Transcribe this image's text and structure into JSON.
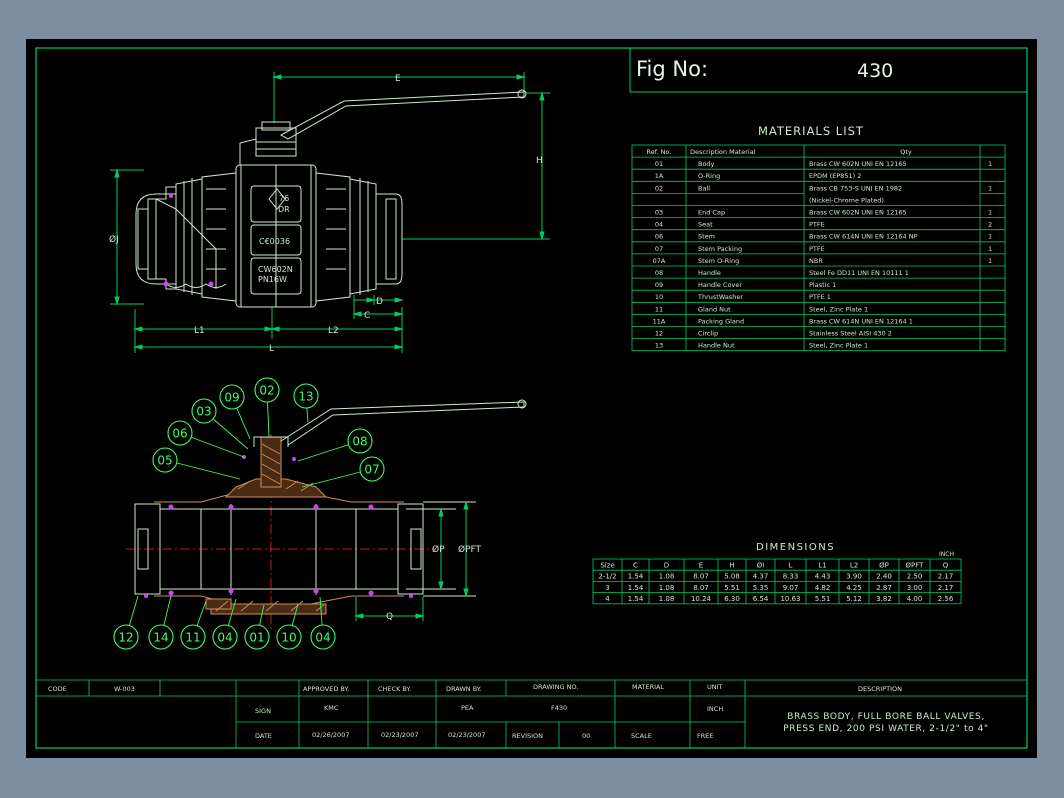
{
  "fig": {
    "label": "Fig  No:",
    "number": "430"
  },
  "materials": {
    "title": "MATERIALS LIST",
    "headers": [
      "Ref. No.",
      "Description  Material",
      "Qty"
    ],
    "rows": [
      [
        "01",
        "Body",
        "Brass CW 602N UNI EN 12165",
        "1"
      ],
      [
        "1A",
        "O-Ring",
        "EPDM (EP851)     2",
        ""
      ],
      [
        "02",
        "Ball",
        "Brass CB 753-S UNI EN 1982",
        "1"
      ],
      [
        "",
        "",
        "(Nickel-Chrome Plated)",
        ""
      ],
      [
        "03",
        "End Cap",
        "Brass CW 602N UNI EN 12165",
        "1"
      ],
      [
        "04",
        "Seat",
        "PTFE",
        "2"
      ],
      [
        "06",
        "Stem",
        "Brass CW 614N UNI EN 12164 NP",
        "1"
      ],
      [
        "07",
        "Stem Packing",
        "PTFE",
        "1"
      ],
      [
        "07A",
        "Stem O-Ring",
        "NBR",
        "1"
      ],
      [
        "08",
        "Handle",
        "Steel Fe DD11 UNI EN 10111  1",
        ""
      ],
      [
        "09",
        "Handle Cover",
        "Plastic                 1",
        ""
      ],
      [
        "10",
        "ThrustWasher",
        "PTFE       1",
        ""
      ],
      [
        "11",
        "Gland Nut",
        "Steel, Zinc Plate    1",
        ""
      ],
      [
        "11A",
        "Packing Gland",
        "Brass CW 614N UNI EN 12164  1",
        ""
      ],
      [
        "12",
        "Circlip",
        "Stainless Steel AISI 430   2",
        ""
      ],
      [
        "13",
        "Handle Nut",
        "Steel, Zinc Plate    1",
        ""
      ]
    ]
  },
  "dimensions": {
    "title": "DIMENSIONS",
    "unit": "INCH",
    "headers": [
      "Size",
      "C",
      "D",
      "E",
      "H",
      "ØI",
      "L",
      "L1",
      "L2",
      "ØP",
      "ØPFT",
      "Q"
    ],
    "rows": [
      [
        "2-1/2",
        "1.54",
        "1.08",
        "8.07",
        "5.08",
        "4.37",
        "8.33",
        "4.43",
        "3.90",
        "2.40",
        "2.50",
        "2.17"
      ],
      [
        "3",
        "1.54",
        "1.08",
        "8.07",
        "5.51",
        "5.35",
        "9.07",
        "4.82",
        "4.25",
        "2.87",
        "3.00",
        "2.17"
      ],
      [
        "4",
        "1.54",
        "1.08",
        "10.24",
        "6.30",
        "6.54",
        "10.63",
        "5.51",
        "5.12",
        "3.82",
        "4.00",
        "2.56"
      ]
    ]
  },
  "view1": {
    "dim_labels": {
      "E": "E",
      "H": "H",
      "I": "ØJ",
      "L1": "L1",
      "L2": "L2",
      "L": "L",
      "C": "C",
      "D": "D"
    },
    "body_marks": [
      "76",
      "DR",
      "C€0036",
      "CW602N",
      "PN16W"
    ]
  },
  "view2": {
    "balloons": [
      "09",
      "02",
      "13",
      "03",
      "06",
      "08",
      "05",
      "07",
      "12",
      "14",
      "11",
      "04",
      "01",
      "10",
      "04"
    ],
    "dim_labels": {
      "P": "ØP",
      "PFT": "ØPFT",
      "Q": "Q"
    }
  },
  "title_block": {
    "code_label": "CODE",
    "code_value": "W-003",
    "approved_label": "APPROVED BY.",
    "check_label": "CHECK BY.",
    "drawn_label": "DRAWN BY.",
    "drawing_no_label": "DRAWING NO.",
    "material_label": "MATERIAL",
    "unit_label": "UNIT",
    "description_label": "DESCRIPTION",
    "sign_label": "SIGN",
    "approved_sign": "KMC",
    "drawn_sign": "PEA",
    "drawing_no": "F430",
    "unit_value": "INCH",
    "date_label": "DATE",
    "approved_date": "02/26/2007",
    "check_date": "02/23/2007",
    "drawn_date": "02/23/2007",
    "revision_label": "REVISION",
    "revision_value": "00",
    "scale_label": "SCALE",
    "scale_value": "FREE",
    "description_line1": "BRASS BODY, FULL BORE BALL VALVES,",
    "description_line2": "PRESS END, 200 PSI WATER, 2-1/2\" to 4\""
  },
  "colors": {
    "background": "#000000",
    "frame": "#00cc66",
    "text": "#cfe8cf",
    "balloon": "#39ff5e",
    "center": "#ff2020",
    "section": "#d08a5a",
    "seal": "#d040ff"
  }
}
